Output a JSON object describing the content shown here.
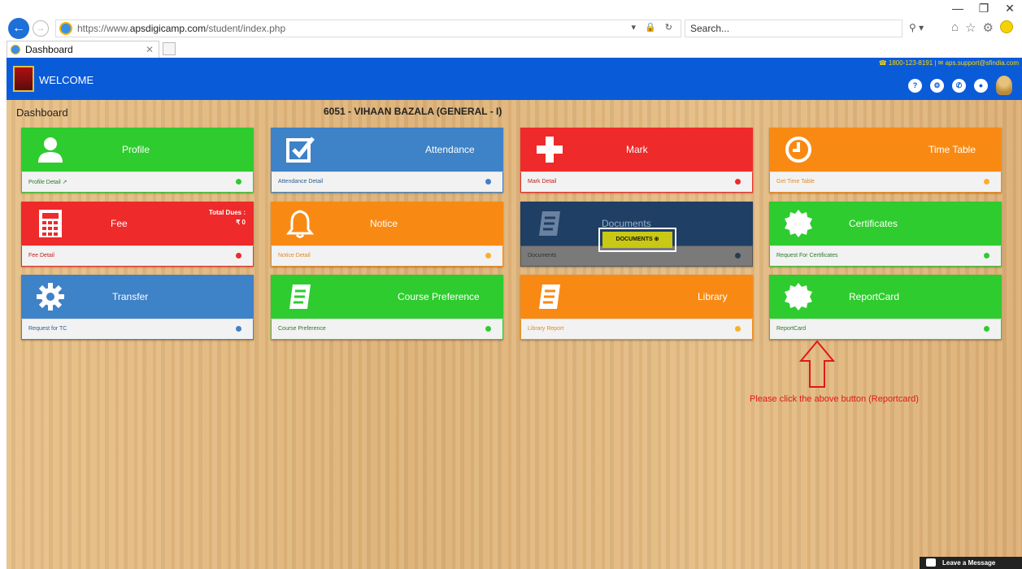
{
  "browser": {
    "url_prefix": "https://www.",
    "url_domain": "apsdigicamp.com",
    "url_path": "/student/index.php",
    "search_placeholder": "Search...",
    "tab_title": "Dashboard"
  },
  "header": {
    "welcome": "WELCOME",
    "contact": "☎ 1800-123-8191 | ✉ aps.support@sfindia.com"
  },
  "main": {
    "title": "Dashboard",
    "student": "6051 - VIHAAN BAZALA (GENERAL - I)"
  },
  "cards": {
    "profile": {
      "title": "Profile",
      "sub": "Profile Detail ↗"
    },
    "attendance": {
      "title": "Attendance",
      "sub": "Attendance Detail"
    },
    "mark": {
      "title": "Mark",
      "sub": "Mark Detail"
    },
    "timetable": {
      "title": "Time Table",
      "sub": "Get Time Table"
    },
    "fee": {
      "title": "Fee",
      "sub": "Fee Detail",
      "dues_label": "Total Dues :",
      "dues_value": "₹ 0"
    },
    "notice": {
      "title": "Notice",
      "sub": "Notice Detail"
    },
    "documents": {
      "title": "Documents",
      "sub": "Documents",
      "button": "DOCUMENTS ⊕"
    },
    "certificates": {
      "title": "Certificates",
      "sub": "Request For Certificates"
    },
    "transfer": {
      "title": "Transfer",
      "sub": "Request for TC"
    },
    "course": {
      "title": "Course Preference",
      "sub": "Course Preference"
    },
    "library": {
      "title": "Library",
      "sub": "Library Report"
    },
    "reportcard": {
      "title": "ReportCard",
      "sub": "ReportCard"
    }
  },
  "hint": "Please click the above button (Reportcard)",
  "leave_message": "Leave a Message",
  "colors": {
    "green": "#2ecc2e",
    "blue": "#3e82c8",
    "red": "#ee2a2a",
    "orange": "#f88a14",
    "header": "#0a5bd8"
  }
}
